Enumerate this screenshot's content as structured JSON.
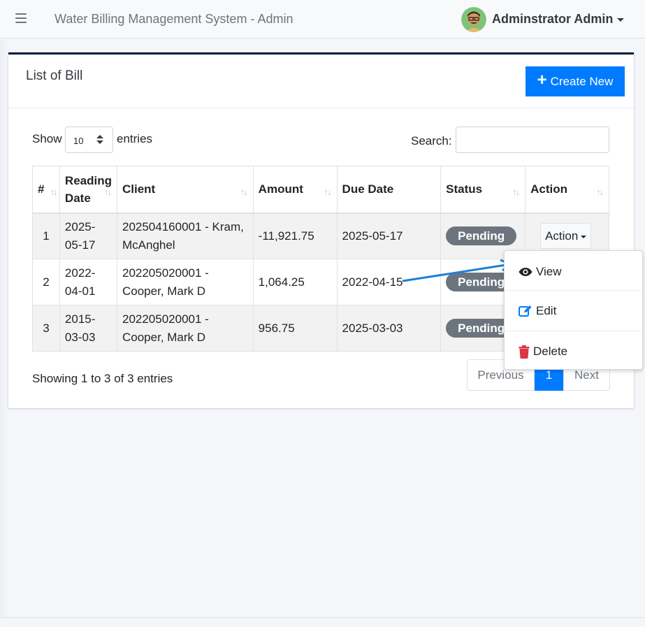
{
  "header": {
    "app_title": "Water Billing Management System - Admin",
    "user_name": "Adminstrator Admin"
  },
  "card": {
    "title": "List of Bill",
    "create_label": "Create New"
  },
  "table_controls": {
    "show_label": "Show",
    "entries_value": "10",
    "entries_label": "entries",
    "search_label": "Search:"
  },
  "columns": {
    "num": "#",
    "reading_date_1": "Reading",
    "reading_date_2": "Date",
    "client": "Client",
    "amount": "Amount",
    "due_date": "Due Date",
    "status": "Status",
    "action": "Action"
  },
  "rows": [
    {
      "num": "1",
      "reading_1": "2025-",
      "reading_2": "05-17",
      "client_1": "202504160001 - Kram,",
      "client_2": "McAnghel",
      "amount": "-11,921.75",
      "due": "2025-05-17",
      "status": "Pending",
      "action": "Action"
    },
    {
      "num": "2",
      "reading_1": "2022-",
      "reading_2": "04-01",
      "client_1": "202205020001 -",
      "client_2": "Cooper, Mark D",
      "amount": "1,064.25",
      "due": "2022-04-15",
      "status": "Pending"
    },
    {
      "num": "3",
      "reading_1": "2015-",
      "reading_2": "03-03",
      "client_1": "202205020001 -",
      "client_2": "Cooper, Mark D",
      "amount": "956.75",
      "due": "2025-03-03",
      "status": "Pending"
    }
  ],
  "footer": {
    "info": "Showing 1 to 3 of 3 entries",
    "previous": "Previous",
    "current_page": "1",
    "next": "Next"
  },
  "dropdown": {
    "view": "View",
    "edit": "Edit",
    "delete": "Delete"
  },
  "colors": {
    "primary": "#007bff",
    "badge": "#6c757d",
    "delete": "#dc3545",
    "card_border": "#001f3f",
    "annotation_arrow": "#1e7fd6"
  }
}
